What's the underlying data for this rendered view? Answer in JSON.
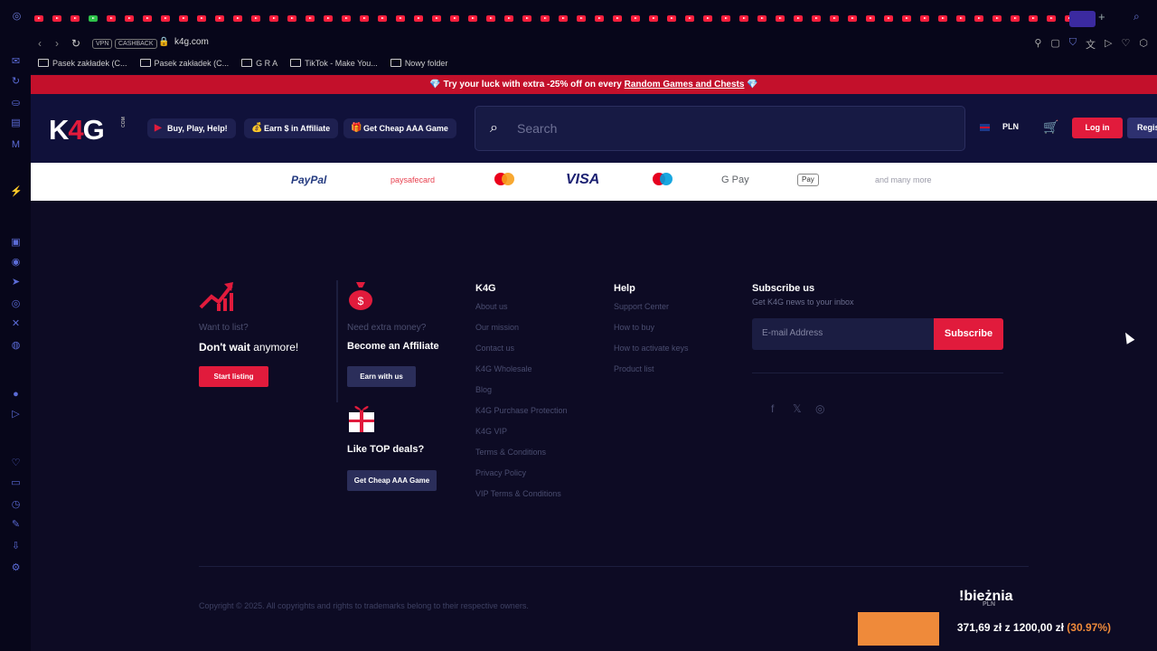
{
  "browser": {
    "tab_count": 59,
    "vpn_label": "VPN",
    "cashback_label": "CASHBACK",
    "url": "k4g.com",
    "bookmarks": [
      "Pasek zakładek (C...",
      "Pasek zakładek (C...",
      "G R A",
      "TikTok - Make You...",
      "Nowy folder"
    ],
    "sidebar_icons": [
      "vk-icon",
      "history-icon",
      "bag-icon",
      "gamepad-icon",
      "mail-icon",
      "aria-icon",
      "twitch-icon",
      "messenger-icon",
      "telegram-icon",
      "instagram-icon",
      "x-icon",
      "discord-icon",
      "music-icon",
      "player-icon",
      "heart-icon",
      "wallet-icon",
      "clock-icon",
      "extensions-icon",
      "download-icon",
      "settings-icon"
    ]
  },
  "promo": {
    "prefix": "💎 Try your luck with extra -25% off on every",
    "link": "Random Games and Chests",
    "suffix": "💎"
  },
  "header": {
    "logo": {
      "k": "K",
      "four": "4",
      "g": "G",
      "com": "COM"
    },
    "nav": [
      {
        "label": "Buy, Play, Help!",
        "icon": "play-icon"
      },
      {
        "label": "Earn $ in Affiliate",
        "icon": "money-icon"
      },
      {
        "label": "Get Cheap AAA Game",
        "icon": "gift-icon"
      }
    ],
    "search_placeholder": "Search",
    "currency": "PLN",
    "login": "Log in",
    "register": "Register"
  },
  "payments": {
    "paypal": "PayPal",
    "paysafecard": "paysafecard",
    "visa": "VISA",
    "gpay": "G Pay",
    "applepay": "Pay",
    "more": "and many more"
  },
  "footer": {
    "list": {
      "question": "Want to list?",
      "title_bold": "Don't wait",
      "title_rest": " anymore!",
      "button": "Start listing"
    },
    "affiliate": {
      "question": "Need extra money?",
      "title": "Become an Affiliate",
      "button": "Earn with us"
    },
    "deals": {
      "title": "Like TOP deals?",
      "button": "Get Cheap AAA Game"
    },
    "k4g": {
      "heading": "K4G",
      "links": [
        "About us",
        "Our mission",
        "Contact us",
        "K4G Wholesale",
        "Blog",
        "K4G Purchase Protection",
        "K4G VIP",
        "Terms & Conditions",
        "Privacy Policy",
        "VIP Terms & Conditions"
      ]
    },
    "help": {
      "heading": "Help",
      "links": [
        "Support Center",
        "How to buy",
        "How to activate keys",
        "Product list"
      ]
    },
    "subscribe": {
      "heading": "Subscribe us",
      "sub": "Get K4G news to your inbox",
      "placeholder": "E-mail Address",
      "button": "Subscribe"
    },
    "copyright": "Copyright © 2025. All copyrights and rights to trademarks belong to their respective owners."
  },
  "overlay": {
    "title": "!bieżnia",
    "sub": "PLN",
    "current": "371,69 zł",
    "of": "z",
    "target": "1200,00 zł",
    "percent": "(30.97%)",
    "progress": 0.3097
  },
  "colors": {
    "accent": "#e11b3c",
    "background": "#0d0b24",
    "header": "#10113a",
    "overlay": "#ef8a3a"
  }
}
